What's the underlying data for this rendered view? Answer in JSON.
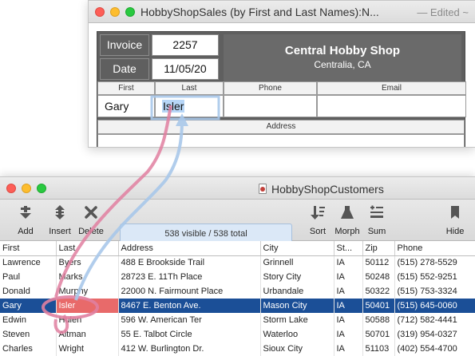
{
  "invoice_window": {
    "title": "HobbyShopSales (by First and Last Names):N...",
    "edited": "— Edited ~",
    "invoice_label": "Invoice",
    "invoice_value": "2257",
    "date_label": "Date",
    "date_value": "11/05/20",
    "company_name": "Central Hobby Shop",
    "company_city": "Centralia, CA",
    "columns": [
      "First",
      "Last",
      "Phone",
      "Email"
    ],
    "first_value": "Gary",
    "last_value": "Isler",
    "address_label": "Address"
  },
  "customers_window": {
    "title": "HobbyShopCustomers",
    "toolbar": {
      "add": "Add",
      "insert": "Insert",
      "delete": "Delete",
      "status": "538 visible / 538 total",
      "sort": "Sort",
      "morph": "Morph",
      "sum": "Sum",
      "hide": "Hide"
    },
    "columns": [
      "First",
      "Last",
      "Address",
      "City",
      "St...",
      "Zip",
      "Phone"
    ],
    "rows": [
      [
        "Lawrence",
        "Byers",
        "488 E Brookside Trail",
        "Grinnell",
        "IA",
        "50112",
        "(515) 278-5529"
      ],
      [
        "Paul",
        "Marks",
        "28723 E. 11Th Place",
        "Story City",
        "IA",
        "50248",
        "(515) 552-9251"
      ],
      [
        "Donald",
        "Murphy",
        "22000 N. Fairmount Place",
        "Urbandale",
        "IA",
        "50322",
        "(515) 753-3324"
      ],
      [
        "Gary",
        "Isler",
        "8467 E. Benton Ave.",
        "Mason City",
        "IA",
        "50401",
        "(515) 645-0060"
      ],
      [
        "Edwin",
        "Hulen",
        "596 W. American Ter",
        "Storm Lake",
        "IA",
        "50588",
        "(712) 582-4441"
      ],
      [
        "Steven",
        "Altman",
        "55 E. Talbot Circle",
        "Waterloo",
        "IA",
        "50701",
        "(319) 954-0327"
      ],
      [
        "Charles",
        "Wright",
        "412 W. Burlington Dr.",
        "Sioux City",
        "IA",
        "51103",
        "(402) 554-4700"
      ]
    ],
    "selected_row": 3
  },
  "colors": {
    "selection": "#1b4f97",
    "editing_cell": "#e86a6a",
    "arrow_pink": "#e07fa0",
    "arrow_blue": "#a9c8ea"
  }
}
